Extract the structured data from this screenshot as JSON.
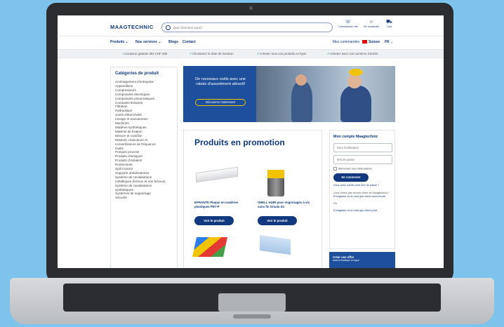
{
  "site": {
    "logo": "MAAGTECHNIC",
    "search_placeholder": "Que cherchez-vous?",
    "header_icons": [
      {
        "icon": "phone-icon",
        "label": "Commander vite"
      },
      {
        "icon": "user-icon",
        "label": "Se connecter"
      },
      {
        "icon": "cart-icon",
        "label": "Cart"
      }
    ],
    "nav": {
      "produits": "Produits",
      "services": "Nos services",
      "blogs": "Blogs",
      "contact": "Contact",
      "mes_commandes": "Mes commandes",
      "country": "Suisse",
      "lang": "FR"
    },
    "usps": [
      "Livraison gratuite dès CHF 250",
      "Choisissez la date de livraison",
      "Achetez tous vos produits en ligne",
      "Achetez avec vos numéros d'article"
    ]
  },
  "sidebar": {
    "title": "Catégories de produit",
    "items": [
      "Aménagement d'entreprise",
      "Appareillons",
      "Compresseurs",
      "Composants électriques",
      "Composants pneumatiques",
      "Conduites linéaires",
      "Filtration",
      "Hydraulique",
      "Joints d'étanchéité",
      "Levage et manutention",
      "Machines",
      "Matières synthétiques",
      "Matériel de fixation",
      "Mesure et contrôle",
      "Moteurs, réducteurs et",
      "convertisseurs de fréquence",
      "Outils",
      "Pompes process",
      "Produits chimiques",
      "Produits d'isolation",
      "Roulements",
      "Spill Control",
      "Supports antivibratoires",
      "Système de canalisations",
      "métalliques (ferreux et non ferreux)",
      "Système de canalisations",
      "synthétiques",
      "Systèmes de supportage",
      "Sécurité"
    ]
  },
  "banner": {
    "text": "De nouveaux outils avec une rabais d'assortiment attractif",
    "button": "Découvrez maintenant"
  },
  "promo": {
    "title": "Produits en promotion",
    "products": [
      {
        "name": "EPRANTE Plaque en matières plastiques PET-P",
        "button": "Voir le produit"
      },
      {
        "name": "SHELL HUIR pour engrenages à vis sans fin Omala S4",
        "button": "Voir le produit"
      }
    ]
  },
  "account": {
    "title": "Mon compte Maagtechnic",
    "user_placeholder": "Nom d'utilisateur",
    "pass_placeholder": "Mot de passe",
    "remember": "Mémoriser mes informations",
    "login_button": "Se connecter",
    "forgot": "Vous avez oublié votre Mot de passe ?",
    "question": "Vous n'êtes pas encore client de Maagtechnic?",
    "register_client": "Enregistrer ici en tant que client commercial",
    "or": "Ou",
    "register_private": "Enregistrer ici en tant que client privé"
  },
  "create_box": {
    "title": "Créer une offre",
    "subtitle": "dans la boutique en ligne"
  }
}
